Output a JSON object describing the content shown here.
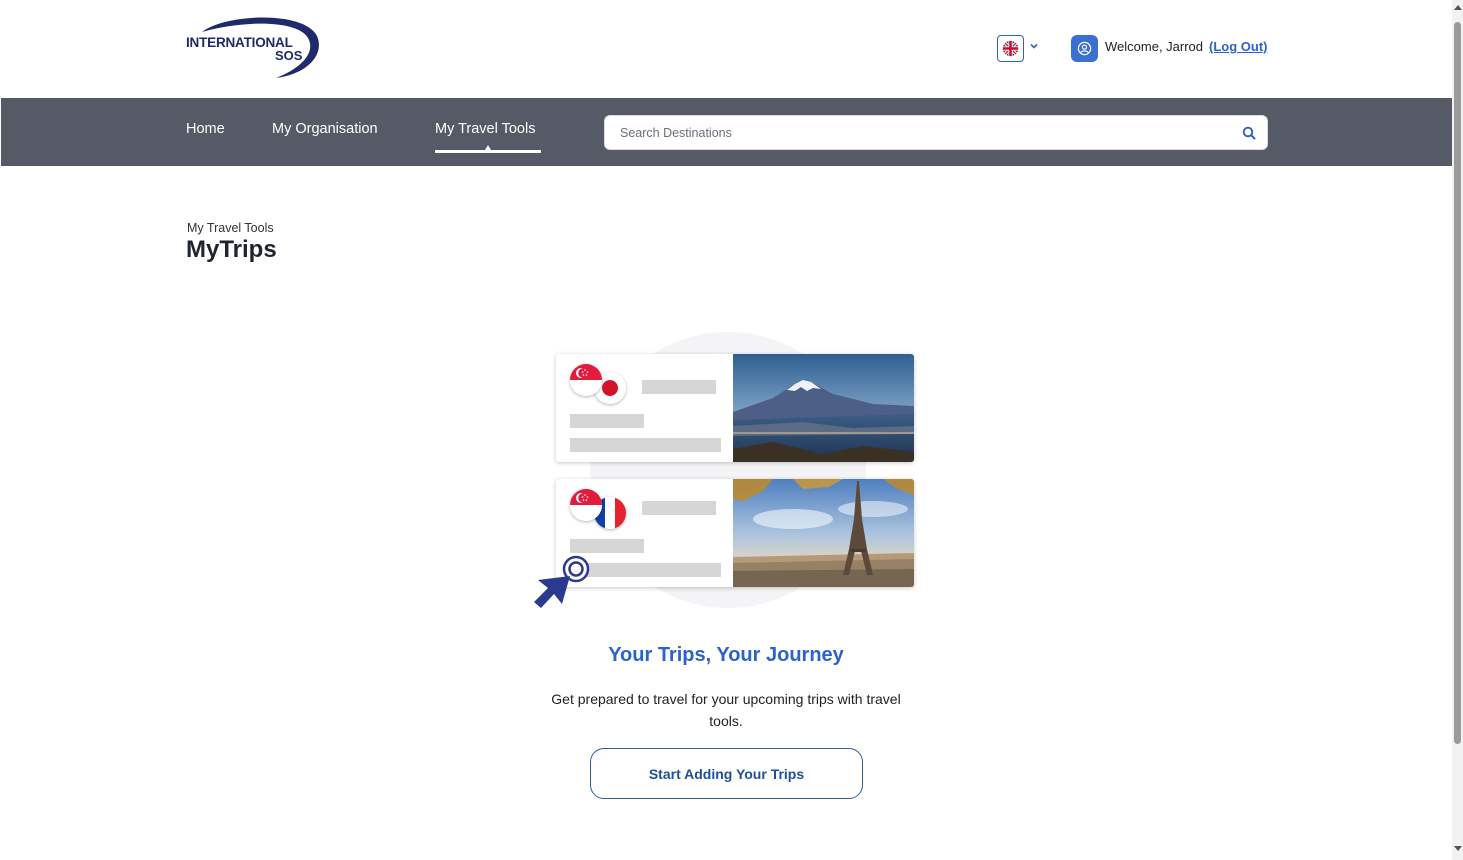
{
  "header": {
    "logo": {
      "line1": "INTERNATIONAL",
      "line2": "SOS",
      "brand_color": "#1f2a6b"
    },
    "language": {
      "selected_flag": "uk-flag-icon"
    },
    "user": {
      "welcome": "Welcome, Jarrod",
      "logout": "(Log Out)"
    }
  },
  "nav": {
    "items": [
      {
        "label": "Home",
        "active": false
      },
      {
        "label": "My Organisation",
        "active": false
      },
      {
        "label": "My Travel Tools",
        "active": true
      }
    ],
    "search": {
      "placeholder": "Search Destinations",
      "value": ""
    },
    "background": "#565a66"
  },
  "page": {
    "breadcrumb": "My Travel Tools",
    "title": "MyTrips"
  },
  "empty_state": {
    "cards": [
      {
        "flags": [
          "singapore-flag-icon",
          "japan-flag-icon"
        ],
        "photo": "mount-fuji-photo"
      },
      {
        "flags": [
          "singapore-flag-icon",
          "france-flag-icon"
        ],
        "photo": "eiffel-tower-photo"
      }
    ],
    "headline": "Your Trips, Your Journey",
    "description": "Get prepared to travel for your upcoming trips with travel tools.",
    "cta": "Start Adding Your Trips",
    "accent": "#2d63c8"
  }
}
